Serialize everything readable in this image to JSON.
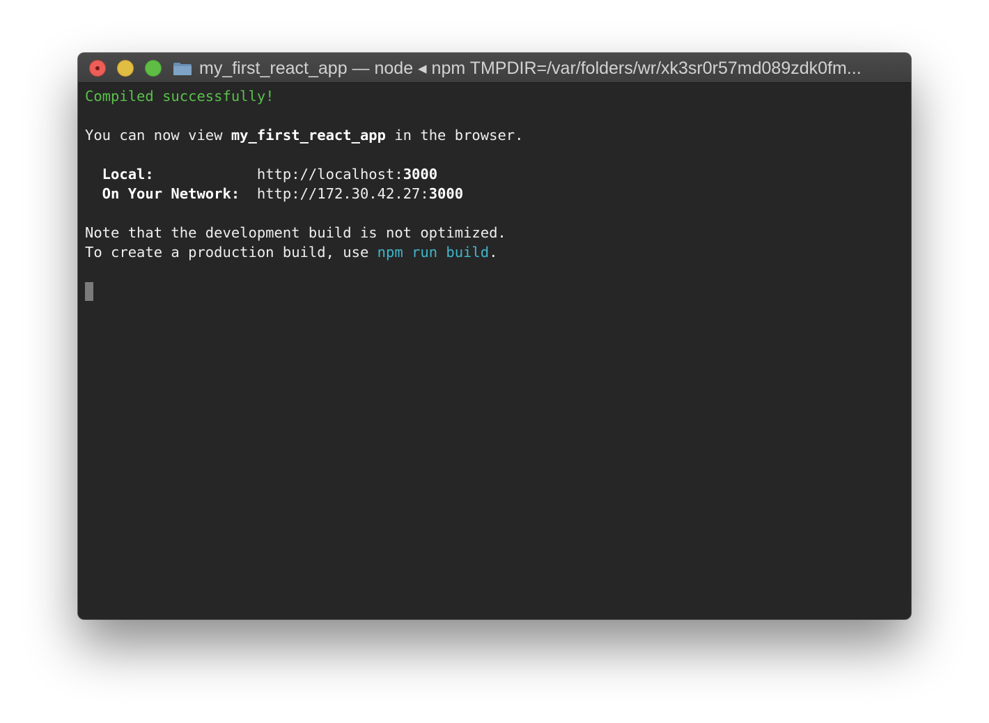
{
  "window": {
    "title": "my_first_react_app — node ◂ npm TMPDIR=/var/folders/wr/xk3sr0r57md089zdk0fm..."
  },
  "terminal": {
    "line1": "Compiled successfully!",
    "line2_pre": "You can now view ",
    "line2_app": "my_first_react_app",
    "line2_post": " in the browser.",
    "local_label": "  Local:",
    "local_pad": "            ",
    "local_url": "http://localhost:",
    "local_port": "3000",
    "network_label": "  On Your Network:",
    "network_pad": "  ",
    "network_url": "http://172.30.42.27:",
    "network_port": "3000",
    "note_line": "Note that the development build is not optimized.",
    "prod_pre": "To create a production build, use ",
    "prod_cmd": "npm run build",
    "prod_post": "."
  },
  "colors": {
    "success": "#59c14a",
    "command": "#3fb6cc",
    "background": "#262626"
  },
  "icons": {
    "close": "close-light",
    "minimize": "minimize-light",
    "zoom": "zoom-light",
    "folder": "folder-icon"
  }
}
